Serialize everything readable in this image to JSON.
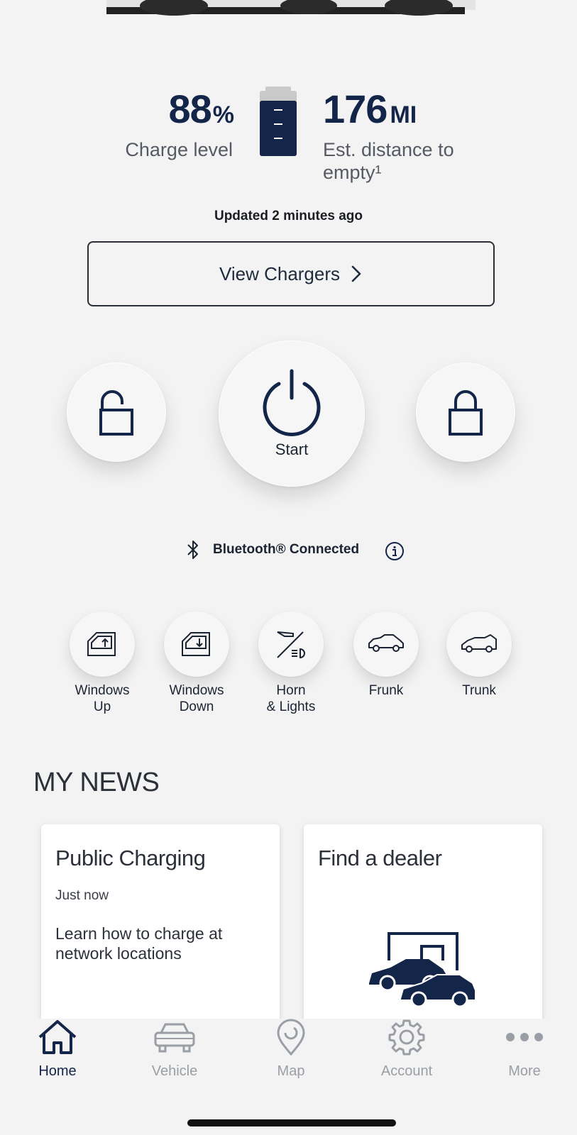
{
  "battery": {
    "charge_value": "88",
    "charge_unit": "%",
    "charge_label": "Charge level",
    "range_value": "176",
    "range_unit": "MI",
    "range_label_1": "Est. distance to",
    "range_label_2": "empty¹",
    "updated": "Updated 2 minutes ago"
  },
  "view_chargers_label": "View Chargers",
  "controls": {
    "start_label": "Start"
  },
  "bluetooth_label": "Bluetooth® Connected",
  "quick_actions": [
    {
      "line1": "Windows",
      "line2": "Up",
      "icon": "window-up-icon"
    },
    {
      "line1": "Windows",
      "line2": "Down",
      "icon": "window-down-icon"
    },
    {
      "line1": "Horn",
      "line2": "& Lights",
      "icon": "horn-lights-icon"
    },
    {
      "line1": "Frunk",
      "line2": "",
      "icon": "frunk-icon"
    },
    {
      "line1": "Trunk",
      "line2": "",
      "icon": "trunk-icon"
    }
  ],
  "news": {
    "title": "MY NEWS",
    "cards": [
      {
        "title": "Public Charging",
        "time": "Just now",
        "body": "Learn how to charge at network locations"
      },
      {
        "title": "Find a dealer",
        "icon": "dealer-icon"
      }
    ]
  },
  "tabs": [
    {
      "label": "Home",
      "icon": "home-icon",
      "active": true
    },
    {
      "label": "Vehicle",
      "icon": "car-icon",
      "active": false
    },
    {
      "label": "Map",
      "icon": "map-pin-icon",
      "active": false
    },
    {
      "label": "Account",
      "icon": "gear-icon",
      "active": false
    },
    {
      "label": "More",
      "icon": "more-dots-icon",
      "active": false
    }
  ],
  "colors": {
    "navy": "#14254a",
    "inactive_tab": "#9a9ea5",
    "background": "#f3f3f3"
  }
}
